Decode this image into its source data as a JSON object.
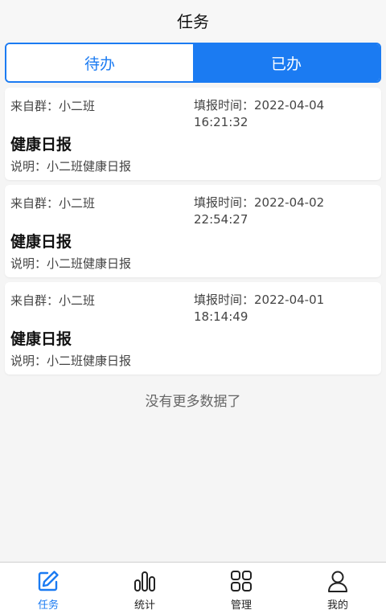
{
  "header": {
    "title": "任务"
  },
  "tabs": [
    {
      "label": "待办",
      "active": false
    },
    {
      "label": "已办",
      "active": true
    }
  ],
  "tasks": [
    {
      "from": "来自群：小二班",
      "time": "填报时间：2022-04-04 16:21:32",
      "title": "健康日报",
      "description": "说明：小二班健康日报"
    },
    {
      "from": "来自群：小二班",
      "time": "填报时间：2022-04-02 22:54:27",
      "title": "健康日报",
      "description": "说明：小二班健康日报"
    },
    {
      "from": "来自群：小二班",
      "time": "填报时间：2022-04-01 18:14:49",
      "title": "健康日报",
      "description": "说明：小二班健康日报"
    }
  ],
  "list_footer": "没有更多数据了",
  "bottom_nav": [
    {
      "label": "任务",
      "icon": "edit-icon",
      "active": true
    },
    {
      "label": "统计",
      "icon": "bar-chart-icon",
      "active": false
    },
    {
      "label": "管理",
      "icon": "grid-icon",
      "active": false
    },
    {
      "label": "我的",
      "icon": "user-icon",
      "active": false
    }
  ],
  "colors": {
    "accent": "#1b7bf2",
    "background": "#f5f5f5"
  }
}
